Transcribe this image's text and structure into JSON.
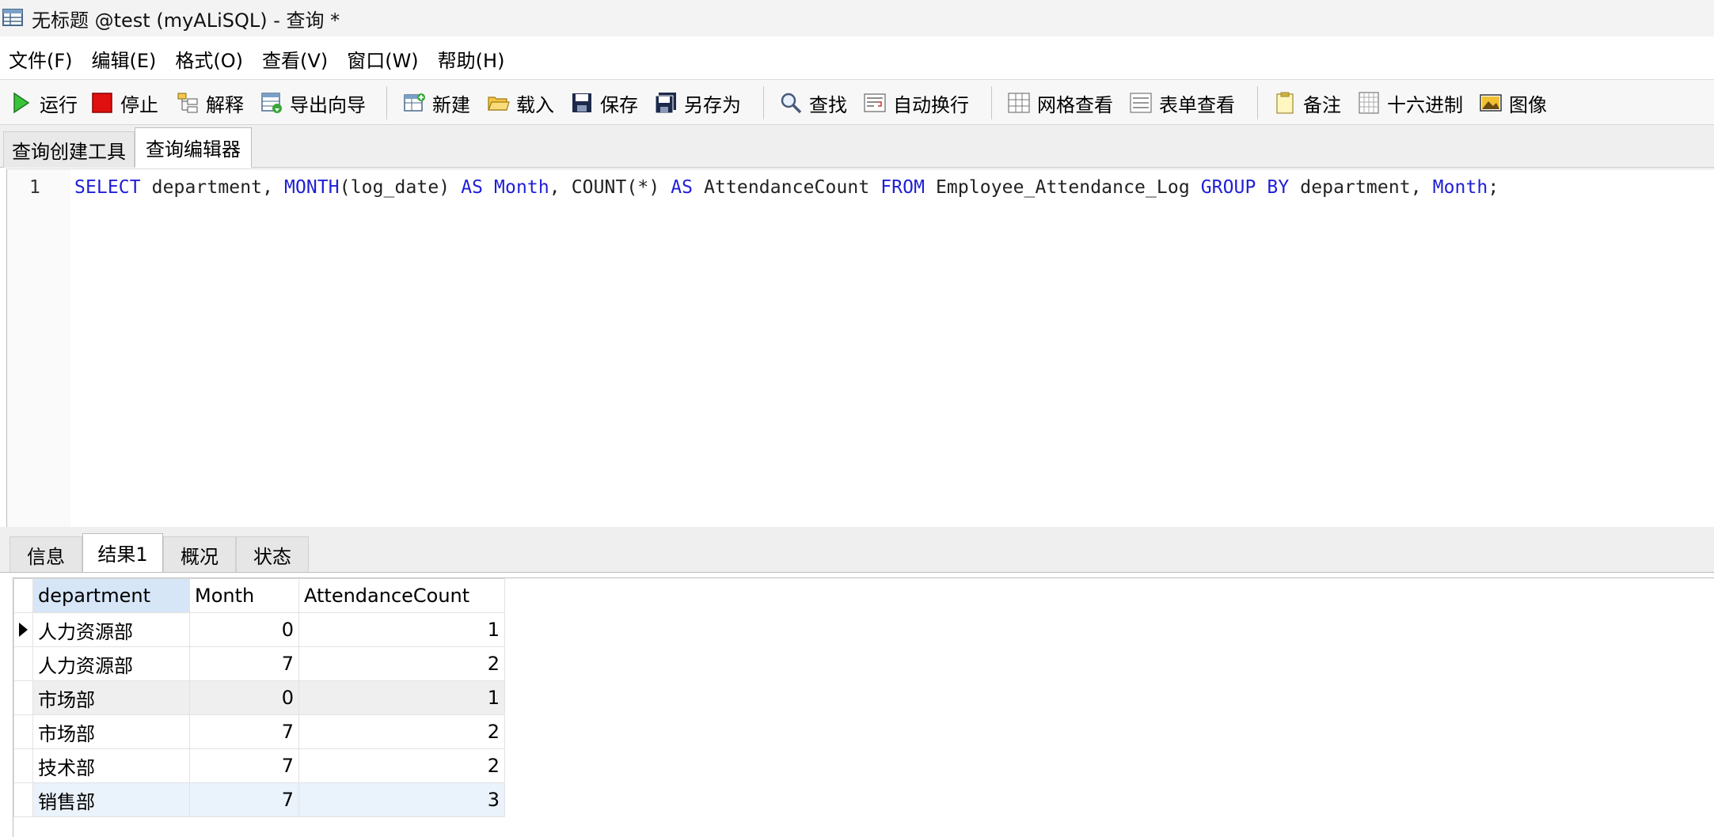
{
  "window": {
    "title": "无标题 @test (myALiSQL) - 查询 *"
  },
  "menu": {
    "items": [
      "文件(F)",
      "编辑(E)",
      "格式(O)",
      "查看(V)",
      "窗口(W)",
      "帮助(H)"
    ]
  },
  "toolbar": {
    "run": "运行",
    "stop": "停止",
    "explain": "解释",
    "export_wizard": "导出向导",
    "new": "新建",
    "load": "载入",
    "save": "保存",
    "save_as": "另存为",
    "find": "查找",
    "word_wrap": "自动换行",
    "grid_view": "网格查看",
    "form_view": "表单查看",
    "memo": "备注",
    "hex": "十六进制",
    "image": "图像"
  },
  "tabs": {
    "builder": "查询创建工具",
    "editor": "查询编辑器"
  },
  "editor": {
    "line_number": "1",
    "tokens": [
      {
        "t": "SELECT",
        "kw": true
      },
      {
        "t": " department, ",
        "kw": false
      },
      {
        "t": "MONTH",
        "kw": true
      },
      {
        "t": "(log_date) ",
        "kw": false
      },
      {
        "t": "AS",
        "kw": true
      },
      {
        "t": " ",
        "kw": false
      },
      {
        "t": "Month",
        "kw": true
      },
      {
        "t": ", COUNT(*) ",
        "kw": false
      },
      {
        "t": "AS",
        "kw": true
      },
      {
        "t": " AttendanceCount ",
        "kw": false
      },
      {
        "t": "FROM",
        "kw": true
      },
      {
        "t": " Employee_Attendance_Log ",
        "kw": false
      },
      {
        "t": "GROUP BY",
        "kw": true
      },
      {
        "t": " department, ",
        "kw": false
      },
      {
        "t": "Month",
        "kw": true
      },
      {
        "t": ";",
        "kw": false
      }
    ]
  },
  "result_tabs": {
    "info": "信息",
    "result1": "结果1",
    "profile": "概况",
    "status": "状态"
  },
  "grid": {
    "columns": [
      "department",
      "Month",
      "AttendanceCount"
    ],
    "rows": [
      {
        "department": "人力资源部",
        "month": "0",
        "count": "1"
      },
      {
        "department": "人力资源部",
        "month": "7",
        "count": "2"
      },
      {
        "department": "市场部",
        "month": "0",
        "count": "1"
      },
      {
        "department": "市场部",
        "month": "7",
        "count": "2"
      },
      {
        "department": "技术部",
        "month": "7",
        "count": "2"
      },
      {
        "department": "销售部",
        "month": "7",
        "count": "3"
      }
    ]
  },
  "colors": {
    "keyword": "#1f1fd6",
    "selected_header": "#d6e6f7",
    "selected_row": "#eaf2fb",
    "stripe": "#efefef"
  }
}
